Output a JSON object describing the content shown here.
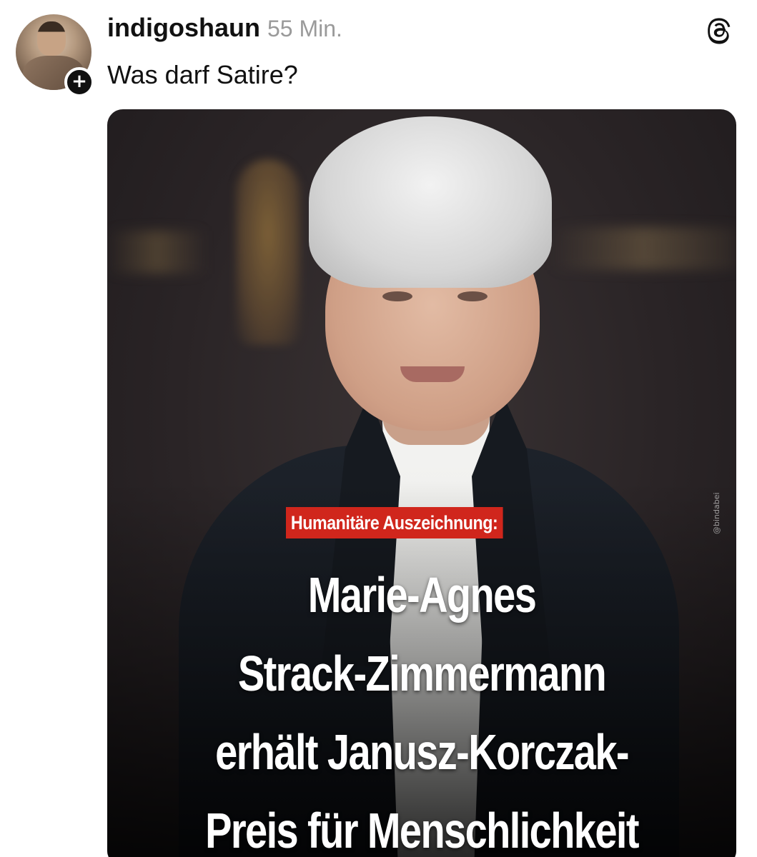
{
  "post": {
    "username": "indigoshaun",
    "timestamp": "55 Min.",
    "caption": "Was darf Satire?",
    "follow_symbol": "+"
  },
  "icons": {
    "app": "threads-icon",
    "follow": "plus-icon"
  },
  "media": {
    "kicker": "Humanitäre Auszeichnung:",
    "headline_lines": [
      "Marie-Agnes",
      "Strack-Zimmermann",
      "erhält Janusz-Korczak-",
      "Preis für Menschlichkeit"
    ],
    "watermark": "@bindabei"
  },
  "colors": {
    "kicker_bg": "#d0261c",
    "headline_text": "#ffffff",
    "timestamp": "#9a9a9a"
  }
}
